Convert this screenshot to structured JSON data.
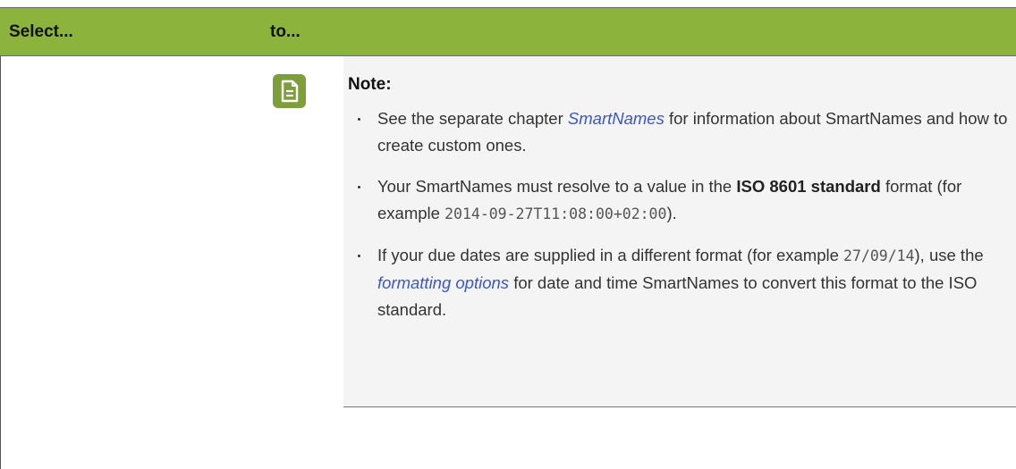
{
  "table": {
    "headers": [
      "Select...",
      "to..."
    ]
  },
  "note": {
    "icon": "note-document-icon",
    "title": "Note:",
    "items": [
      {
        "before": "See the separate chapter ",
        "link": "SmartNames",
        "after": " for information about SmartNames and how to create custom ones."
      },
      {
        "before": "Your SmartNames must resolve to a value in the ",
        "bold": "ISO 8601 standard",
        "middle": " format (for example ",
        "code": "2014-09-27T11:08:00+02:00",
        "after": ")."
      },
      {
        "before": "If your due dates are supplied in a different format (for example ",
        "code": "27/09/14",
        "middle": "), use the ",
        "link": "formatting options",
        "after": " for date and time SmartNames to convert this format to the ISO standard."
      }
    ]
  },
  "colors": {
    "header_bg": "#8cb43c",
    "note_bg": "#f4f4f4",
    "icon_bg": "#7c9e3b",
    "link": "#3b57c8"
  }
}
